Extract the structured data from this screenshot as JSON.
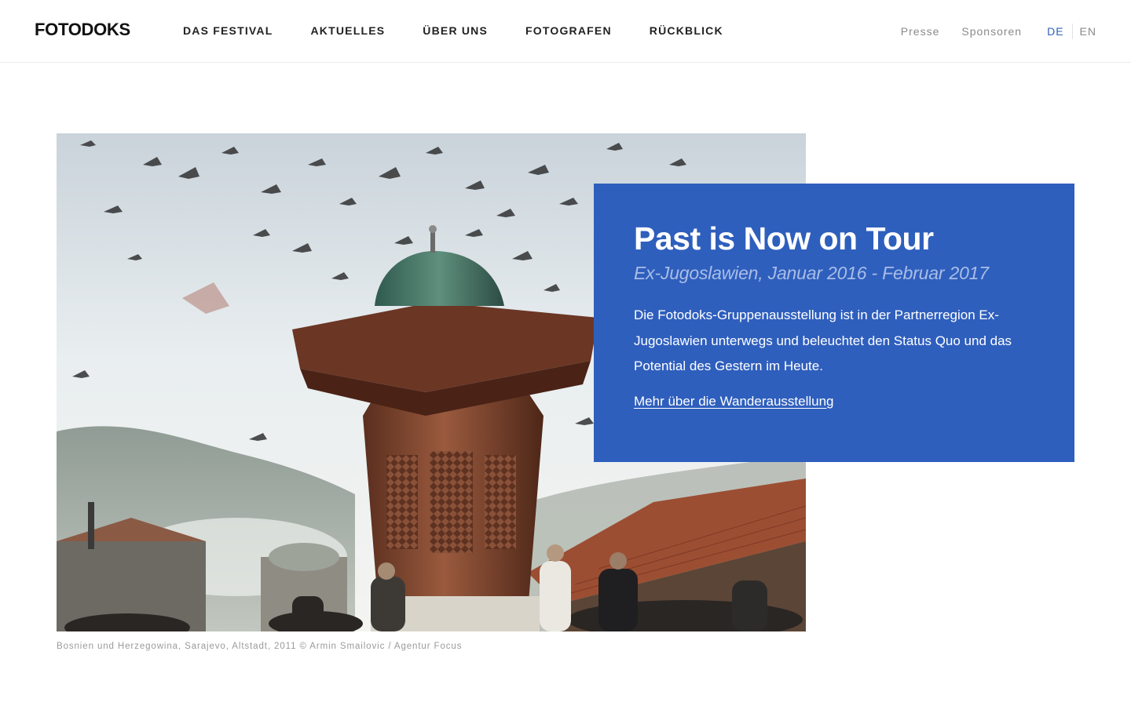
{
  "header": {
    "logo": "FOTODOKS",
    "nav": [
      {
        "label": "DAS FESTIVAL"
      },
      {
        "label": "AKTUELLES"
      },
      {
        "label": "ÜBER UNS"
      },
      {
        "label": "FOTOGRAFEN"
      },
      {
        "label": "RÜCKBLICK"
      }
    ],
    "meta": [
      {
        "label": "Presse"
      },
      {
        "label": "Sponsoren"
      }
    ],
    "languages": [
      {
        "label": "DE",
        "active": true
      },
      {
        "label": "EN",
        "active": false
      }
    ]
  },
  "hero": {
    "image_alt": "Sebilj-Brunnen in Sarajevo mit auffliegenden Tauben",
    "caption": "Bosnien und Herzegowina, Sarajevo, Altstadt, 2011 © Armin Smailovic / Agentur Focus"
  },
  "teaser": {
    "title": "Past is Now on Tour",
    "subtitle": "Ex-Jugoslawien, Januar 2016 - Februar 2017",
    "text": "Die Fotodoks-Gruppenausstellung ist in der Partnerregion Ex-Jugoslawien unterwegs und beleuchtet den Status Quo und das Potential des Gestern im Heute.",
    "link": "Mehr über die Wanderausstellung"
  },
  "colors": {
    "accent": "#2f5fbd",
    "subtitle": "#a9bde6",
    "text_dark": "#222222",
    "text_muted": "#8a8a8a"
  }
}
